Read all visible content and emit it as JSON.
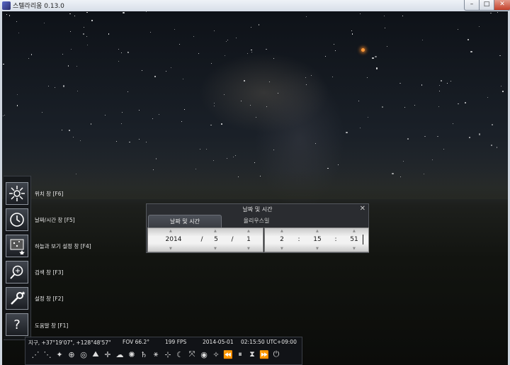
{
  "window": {
    "title": "스텔라리움 0.13.0",
    "min_glyph": "–",
    "max_glyph": "□",
    "close_glyph": "✕"
  },
  "left_panel": [
    {
      "icon": "location-icon",
      "label": "위치 창 [F6]"
    },
    {
      "icon": "clock-icon",
      "label": "날짜/시간 창 [F5]"
    },
    {
      "icon": "sky-view-icon",
      "label": "하늘과 보기 설정 창 [F4]"
    },
    {
      "icon": "search-icon",
      "label": "검색 창 [F3]"
    },
    {
      "icon": "wrench-icon",
      "label": "설정 창 [F2]"
    },
    {
      "icon": "help-icon",
      "label": "도움말 창 [F1]",
      "glyph": "?"
    }
  ],
  "dialog": {
    "title": "날짜 및 시간",
    "close_glyph": "✕",
    "tabs": [
      "날짜 및 시간",
      "율리우스일"
    ],
    "year": "2014",
    "month": "5",
    "day": "1",
    "hour": "2",
    "minute": "15",
    "second": "51",
    "date_sep": "/",
    "time_sep": ":"
  },
  "status": {
    "location": "지구, +37°19'07\", +128°48'57\"",
    "fov": "FOV 66.2°",
    "fps": "199 FPS",
    "date": "2014-05-01",
    "time": "02:15:50 UTC+09:00"
  },
  "bottom_buttons": [
    {
      "icon": "constellation-lines-icon",
      "glyph": "⋰"
    },
    {
      "icon": "constellation-labels-icon",
      "glyph": "⋱"
    },
    {
      "icon": "constellation-art-icon",
      "glyph": "✦"
    },
    {
      "icon": "equatorial-grid-icon",
      "glyph": "⊕"
    },
    {
      "icon": "azimuthal-grid-icon",
      "glyph": "◎"
    },
    {
      "icon": "ground-icon",
      "glyph": "⛰"
    },
    {
      "icon": "cardinal-points-icon",
      "glyph": "✛"
    },
    {
      "icon": "atmosphere-icon",
      "glyph": "☁"
    },
    {
      "icon": "nebulae-icon",
      "glyph": "✺"
    },
    {
      "icon": "planets-labels-icon",
      "glyph": "♄"
    },
    {
      "icon": "equatorial-mount-icon",
      "glyph": "⚹"
    },
    {
      "icon": "center-object-icon",
      "glyph": "⊹"
    },
    {
      "icon": "night-mode-icon",
      "glyph": "☾"
    },
    {
      "icon": "full-screen-icon",
      "glyph": "⤧"
    },
    {
      "icon": "ocular-icon",
      "glyph": "◉"
    },
    {
      "icon": "satellites-icon",
      "glyph": "✧"
    },
    {
      "icon": "decrease-speed-icon",
      "glyph": "⏪"
    },
    {
      "icon": "pause-icon",
      "glyph": "⏸"
    },
    {
      "icon": "current-time-icon",
      "glyph": "⧗"
    },
    {
      "icon": "increase-speed-icon",
      "glyph": "⏩"
    },
    {
      "icon": "quit-icon",
      "glyph": "⏻"
    }
  ]
}
